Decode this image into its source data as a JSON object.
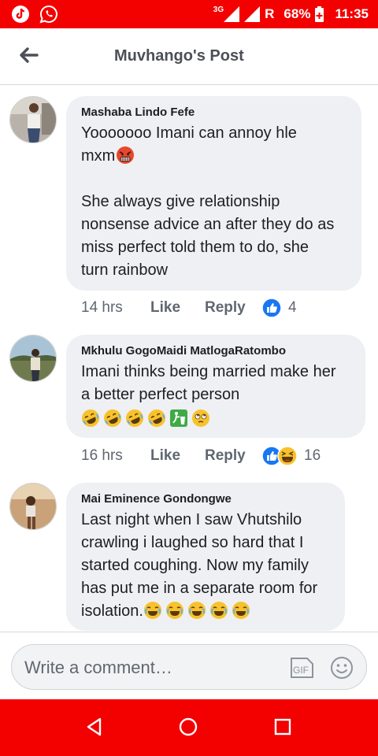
{
  "status_bar": {
    "network_small": "3G",
    "roaming": "R",
    "battery": "68%",
    "time": "11:35",
    "icons": [
      "tiktok-icon",
      "whatsapp-icon",
      "signal-icon",
      "battery-icon"
    ]
  },
  "header": {
    "title": "Muvhango's Post",
    "back_icon": "arrow-left-icon"
  },
  "comments": [
    {
      "author": "Mashaba Lindo Fefe",
      "lines": [
        "Yooooooo Imani can annoy hle",
        "mxm",
        "",
        "She always give relationship",
        "nonsense advice an after they do as",
        "miss perfect told them to do, she",
        "turn rainbow"
      ],
      "emojis_inline": [
        "angry-face-emoji"
      ],
      "time": "14 hrs",
      "like_label": "Like",
      "reply_label": "Reply",
      "reactions": [
        "like"
      ],
      "reaction_count": "4"
    },
    {
      "author": "Mkhulu GogoMaidi MatlogaRatombo",
      "lines": [
        "Imani thinks being married make her",
        "a better perfect person"
      ],
      "emojis_line": [
        "rofl-emoji",
        "rofl-emoji",
        "rofl-emoji",
        "rofl-emoji",
        "trash-emoji",
        "eye-roll-emoji"
      ],
      "time": "16 hrs",
      "like_label": "Like",
      "reply_label": "Reply",
      "reactions": [
        "like",
        "haha"
      ],
      "reaction_count": "16"
    },
    {
      "author": "Mai Eminence Gondongwe",
      "lines": [
        "Last night when I saw Vhutshilo",
        "crawling i laughed so hard that I",
        "started coughing. Now my family",
        "has put me in a separate room for",
        "isolation."
      ],
      "emojis_inline": [
        "tears-of-joy-emoji",
        "tears-of-joy-emoji",
        "tears-of-joy-emoji",
        "tears-of-joy-emoji",
        "tears-of-joy-emoji"
      ]
    }
  ],
  "composer": {
    "placeholder": "Write a comment…",
    "gif_label": "GIF",
    "emoji_icon": "smiley-icon"
  },
  "nav_bar": {
    "icons": [
      "back-triangle-icon",
      "home-circle-icon",
      "recents-square-icon"
    ]
  },
  "colors": {
    "status_bar": "#f30000",
    "bubble": "#eef0f3",
    "like_blue": "#1877f2"
  }
}
